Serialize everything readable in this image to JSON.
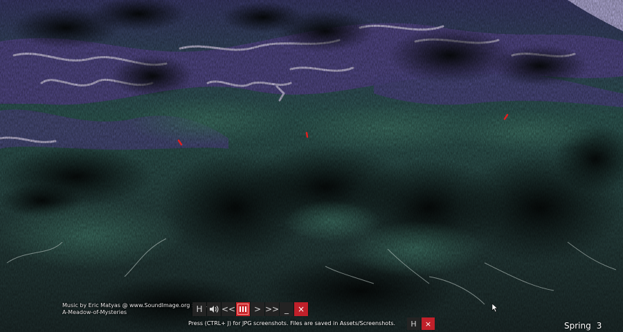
{
  "scene": {
    "colors": {
      "water": "#5a4f8a",
      "foam": "#c9c3dd",
      "forest": "#2e5c52",
      "dark_forest": "#0f1a1a",
      "sky": "#b7b0dd",
      "marker": "#e02020"
    }
  },
  "credits": {
    "line1": "Music by Eric Matyas @ www.SoundImage.org : . . . .",
    "line2": "A-Meadow-of-Mysteries"
  },
  "toolbar": {
    "hide_label": "H",
    "sound_icon": "speaker-icon",
    "rewind_label": "<<",
    "pause_icon": "pause-bars-icon",
    "play_label": ">",
    "fast_forward_label": ">>",
    "minimize_label": "_",
    "close_label": "×"
  },
  "hint": {
    "text": "Press (CTRL+ J) for JPG screenshots.  Files are saved in Assets/Screenshots."
  },
  "toolbar2": {
    "hide_label": "H",
    "close_label": "×"
  },
  "season": {
    "name": "Spring",
    "number": "3"
  }
}
